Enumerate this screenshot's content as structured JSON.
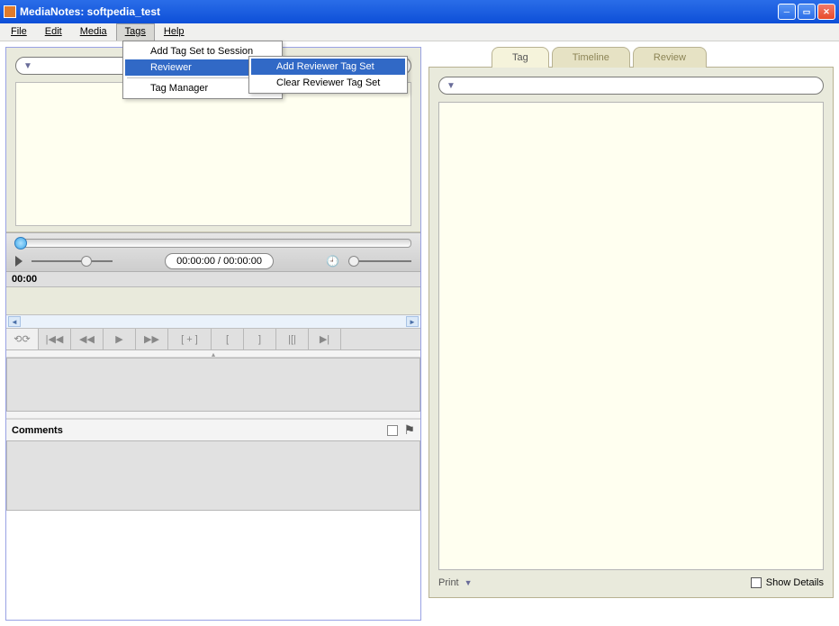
{
  "titlebar": {
    "title": "MediaNotes: softpedia_test"
  },
  "menu": {
    "file": "File",
    "edit": "Edit",
    "media": "Media",
    "tags": "Tags",
    "help": "Help"
  },
  "tagsMenu": {
    "addSet": "Add Tag Set to Session",
    "reviewer": "Reviewer",
    "manager": "Tag Manager"
  },
  "reviewerSub": {
    "add": "Add Reviewer Tag Set",
    "clear": "Clear Reviewer Tag Set"
  },
  "player": {
    "time": "00:00:00 / 00:00:00",
    "tc": "00:00"
  },
  "transport": {
    "loop": "⟲⟳",
    "first": "|◀◀",
    "back": "◀◀",
    "play": "▶",
    "fwd": "▶▶",
    "brkin": "[ + ]",
    "brkopen": "[",
    "brkclose": "]",
    "prevclip": "|[|",
    "nextclip": "▶|"
  },
  "comments": {
    "header": "Comments"
  },
  "tabs": {
    "tag": "Tag",
    "timeline": "Timeline",
    "review": "Review"
  },
  "rightfoot": {
    "print": "Print",
    "details": "Show Details"
  }
}
